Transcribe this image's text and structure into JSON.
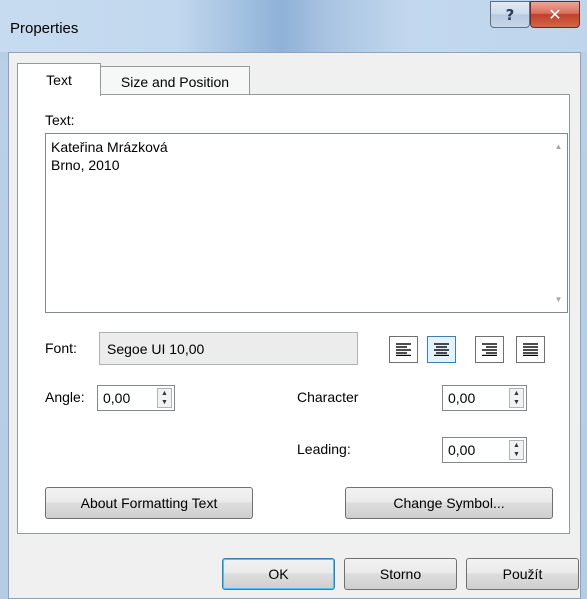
{
  "window": {
    "title": "Properties",
    "help_symbol": "?",
    "close_symbol": "✕"
  },
  "tabs": [
    {
      "label": "Text",
      "active": true
    },
    {
      "label": "Size and Position",
      "active": false
    }
  ],
  "text_section": {
    "label": "Text:",
    "value": "Kateřina Mrázková\nBrno, 2010"
  },
  "font": {
    "label": "Font:",
    "value": "Segoe UI 10,00"
  },
  "alignment": {
    "options": [
      "align-left",
      "align-center",
      "align-right",
      "align-justify"
    ],
    "selected": "align-center"
  },
  "angle": {
    "label": "Angle:",
    "value": "0,00"
  },
  "character": {
    "label": "Character",
    "value": "0,00"
  },
  "leading": {
    "label": "Leading:",
    "value": "0,00"
  },
  "buttons": {
    "about_formatting": "About Formatting Text",
    "change_symbol": "Change Symbol...",
    "ok": "OK",
    "cancel": "Storno",
    "apply": "Použít"
  },
  "colors": {
    "accent": "#3c7fb1",
    "close_red": "#c1402a"
  }
}
